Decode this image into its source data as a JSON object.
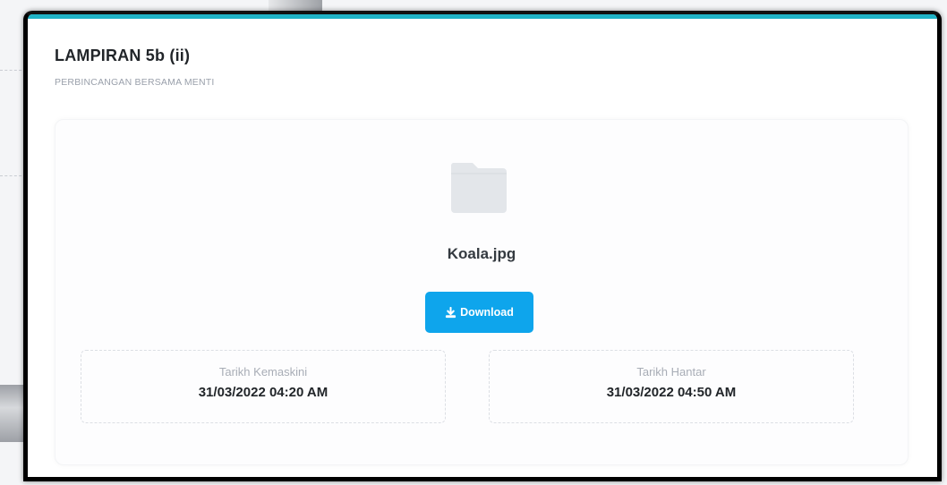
{
  "attachment": {
    "title": "LAMPIRAN 5b (ii)",
    "subtitle": "PERBINCANGAN BERSAMA MENTI",
    "file_icon": "folder-icon",
    "file_name": "Koala.jpg",
    "download_label": "Download",
    "download_icon": "download-icon",
    "updated": {
      "label": "Tarikh Kemaskini",
      "value": "31/03/2022 04:20 AM"
    },
    "submitted": {
      "label": "Tarikh Hantar",
      "value": "31/03/2022 04:50 AM"
    }
  },
  "colors": {
    "accent": "#1fb3c6",
    "button": "#0ea5ec",
    "folder": "#e3e6ea"
  }
}
